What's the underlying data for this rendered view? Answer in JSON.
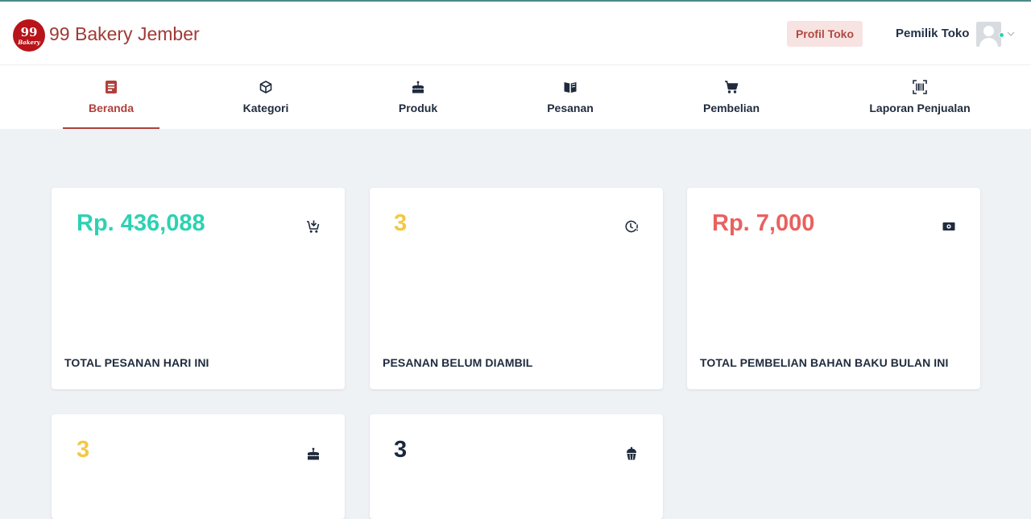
{
  "header": {
    "logo_number": "99",
    "logo_script": "Bakery",
    "brand_name": "99 Bakery Jember",
    "profile_button": "Profil Toko",
    "user_name": "Pemilik Toko"
  },
  "nav": {
    "items": [
      {
        "label": "Beranda",
        "icon": "document-icon",
        "active": true
      },
      {
        "label": "Kategori",
        "icon": "cube-icon",
        "active": false
      },
      {
        "label": "Produk",
        "icon": "cake-icon",
        "active": false
      },
      {
        "label": "Pesanan",
        "icon": "book-icon",
        "active": false
      },
      {
        "label": "Pembelian",
        "icon": "cart-icon",
        "active": false
      },
      {
        "label": "Laporan Penjualan",
        "icon": "barcode-icon",
        "active": false
      }
    ]
  },
  "cards": [
    {
      "value": "Rp. 436,088",
      "caption": "TOTAL PESANAN HARI INI",
      "icon": "cart-plus-icon",
      "color": "#2cd2b3"
    },
    {
      "value": "3",
      "caption": "PESANAN BELUM DIAMBIL",
      "icon": "clock-alert-icon",
      "color": "#f5c842"
    },
    {
      "value": "Rp. 7,000",
      "caption": "TOTAL PEMBELIAN BAHAN BAKU BULAN INI",
      "icon": "cash-icon",
      "color": "#e8615f"
    },
    {
      "value": "3",
      "caption": "",
      "icon": "cake-icon",
      "color": "#f5c842"
    },
    {
      "value": "3",
      "caption": "",
      "icon": "cupcake-icon",
      "color": "#1a2740"
    }
  ],
  "colors": {
    "brand": "#a03a35",
    "accent_active": "#b0403b",
    "background": "#eff2f5"
  }
}
